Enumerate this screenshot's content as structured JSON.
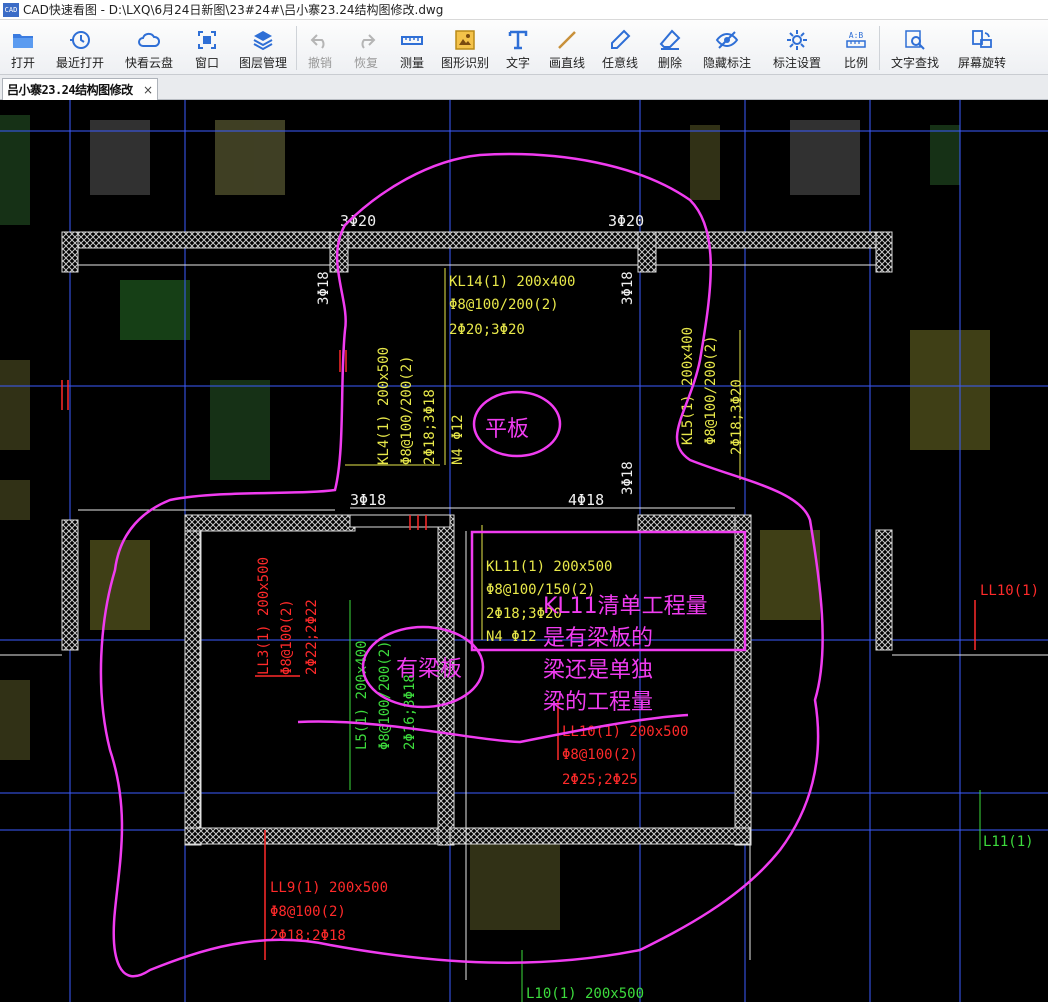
{
  "window": {
    "app_name": "CAD快速看图",
    "title": "CAD快速看图 - D:\\LXQ\\6月24日新图\\23#24#\\吕小寨23.24结构图修改.dwg",
    "icon_text": "CAD"
  },
  "toolbar": [
    {
      "key": "open",
      "label": "打开",
      "icon": "folder-icon"
    },
    {
      "key": "recent",
      "label": "最近打开",
      "icon": "clock-history-icon"
    },
    {
      "key": "cloud",
      "label": "快看云盘",
      "icon": "cloud-icon"
    },
    {
      "key": "window",
      "label": "窗口",
      "icon": "window-frame-icon"
    },
    {
      "key": "layers",
      "label": "图层管理",
      "icon": "layers-icon"
    },
    {
      "key": "undo",
      "label": "撤销",
      "icon": "undo-icon",
      "disabled": true
    },
    {
      "key": "redo",
      "label": "恢复",
      "icon": "redo-icon",
      "disabled": true
    },
    {
      "key": "measure",
      "label": "测量",
      "icon": "ruler-icon"
    },
    {
      "key": "shape",
      "label": "图形识别",
      "icon": "shape-recognition-icon"
    },
    {
      "key": "text",
      "label": "文字",
      "icon": "text-t-icon"
    },
    {
      "key": "line",
      "label": "画直线",
      "icon": "line-icon"
    },
    {
      "key": "freeline",
      "label": "任意线",
      "icon": "pen-icon"
    },
    {
      "key": "delete",
      "label": "删除",
      "icon": "eraser-icon"
    },
    {
      "key": "hide",
      "label": "隐藏标注",
      "icon": "eye-hidden-icon"
    },
    {
      "key": "annoset",
      "label": "标注设置",
      "icon": "gear-annotation-icon"
    },
    {
      "key": "scale",
      "label": "比例",
      "icon": "scale-ratio-icon",
      "badge": "A:B"
    },
    {
      "key": "findtext",
      "label": "文字查找",
      "icon": "search-text-icon"
    },
    {
      "key": "rotate",
      "label": "屏幕旋转",
      "icon": "screen-rotate-icon"
    }
  ],
  "tab": {
    "label": "吕小寨23.24结构图修改",
    "close": "×"
  },
  "colors": {
    "yellow": "#e8e84a",
    "red": "#ff2a2a",
    "green": "#3ddc3d",
    "magenta": "#f03cf0",
    "blue": "#3b5cff",
    "white": "#ffffff"
  },
  "drawing": {
    "rebar_top_left": "3Φ20",
    "rebar_top_right": "3Φ20",
    "rebar_left_vert": "3Φ18",
    "rebar_right_vert": "3Φ18",
    "kl14": [
      "KL14(1) 200x400",
      "Φ8@100/200(2)",
      "2Φ20;3Φ20"
    ],
    "kl4": [
      "KL4(1) 200x500",
      "Φ8@100/200(2)",
      "2Φ18;3Φ18",
      "N4 Φ12"
    ],
    "kl5": [
      "KL5(1) 200x400",
      "Φ8@100/200(2)",
      "2Φ18;3Φ20"
    ],
    "rebar_mid_right_vert": "3Φ18",
    "rebar_mid_left": "3Φ18",
    "rebar_mid_right": "4Φ18",
    "kl11": [
      "KL11(1) 200x500",
      "Φ8@100/150(2)",
      "2Φ18;3Φ20",
      "N4 Φ12"
    ],
    "ll3": [
      "LL3(1) 200x500",
      "Φ8@100(2)",
      "2Φ22;2Φ22"
    ],
    "l5": [
      "L5(1) 200x400",
      "Φ8@100/200(2)",
      "2Φ16;3Φ18"
    ],
    "ll10_right": "LL10(1)",
    "ll10_mid": [
      "LL10(1) 200x500",
      "Φ8@100(2)",
      "2Φ25;2Φ25"
    ],
    "ll9": [
      "LL9(1) 200x500",
      "Φ8@100(2)",
      "2Φ18;2Φ18"
    ],
    "l11": "L11(1)",
    "l10_bottom": "L10(1) 200x500"
  },
  "annotations": {
    "flat_slab": "平板",
    "beam_slab": "有梁板",
    "question": [
      "KL11清单工程量",
      "是有梁板的",
      "梁还是单独",
      "梁的工程量"
    ]
  }
}
